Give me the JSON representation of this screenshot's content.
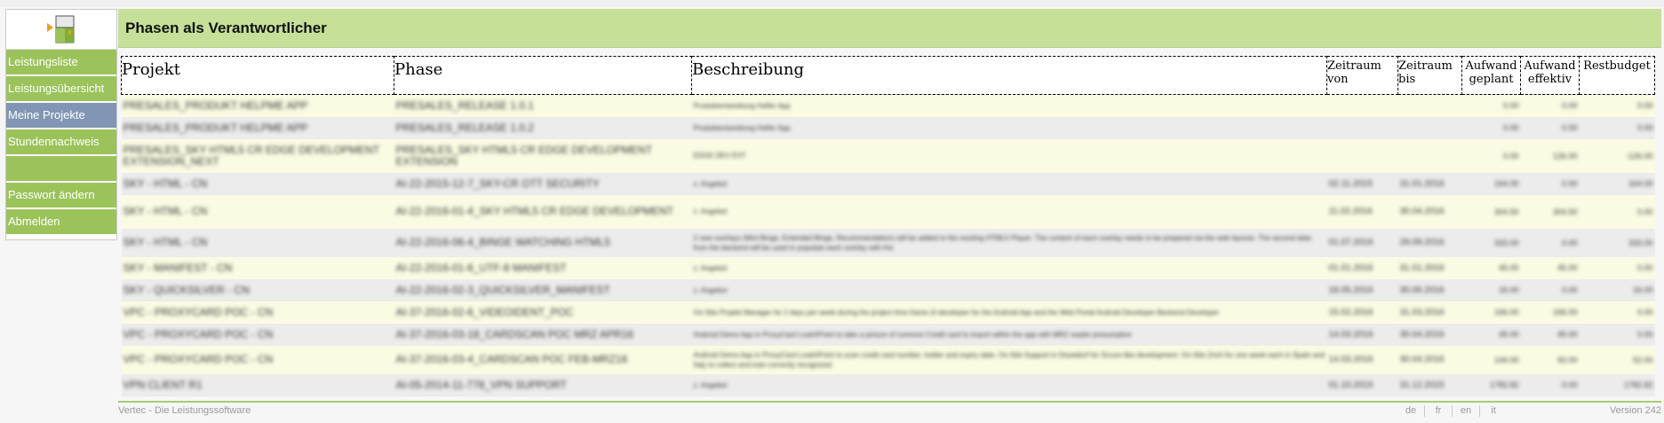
{
  "sidebar": {
    "items": [
      {
        "label": "Leistungsliste",
        "active": false
      },
      {
        "label": "Leistungsübersicht",
        "active": false
      },
      {
        "label": "Meine Projekte",
        "active": true
      },
      {
        "label": "Stundennachweis",
        "active": false
      },
      {
        "label": "",
        "active": false
      },
      {
        "label": "Passwort ändern",
        "active": false
      },
      {
        "label": "Abmelden",
        "active": false
      }
    ]
  },
  "header": {
    "title": "Phasen als Verantwortlicher"
  },
  "table": {
    "columns": {
      "projekt": "Projekt",
      "phase": "Phase",
      "beschreibung": "Beschreibung",
      "zeitraum_von": "Zeitraum von",
      "zeitraum_bis": "Zeitraum bis",
      "aufwand_geplant": "Aufwand geplant",
      "aufwand_effektiv": "Aufwand effektiv",
      "restbudget": "Restbudget"
    },
    "rows": [
      {
        "projekt": "PRESALES_PRODUKT HELPME APP",
        "phase": "PRESALES_RELEASE 1.0.1",
        "beschreibung": "Produktentwicklung Helfer App",
        "von": "",
        "bis": "",
        "geplant": "0.00",
        "effektiv": "0.00",
        "rest": "0.00"
      },
      {
        "projekt": "PRESALES_PRODUKT HELPME APP",
        "phase": "PRESALES_RELEASE 1.0.2",
        "beschreibung": "Produktentwicklung Helfer App",
        "von": "",
        "bis": "",
        "geplant": "0.00",
        "effektiv": "0.00",
        "rest": "0.00"
      },
      {
        "projekt": "PRESALES_SKY HTML5 CR EDGE DEVELOPMENT EXTENSION_NEXT",
        "phase": "PRESALES_SKY HTML5 CR EDGE DEVELOPMENT EXTENSION",
        "beschreibung": "EDGE DEV EXT",
        "von": "",
        "bis": "",
        "geplant": "0.00",
        "effektiv": "126.00",
        "rest": "-126.00"
      },
      {
        "projekt": "SKY - HTML - CN",
        "phase": "AI-22-2015-12-7_SKY-CR OTT SECURITY",
        "beschreibung": "z. Angebot",
        "von": "02.11.2015",
        "bis": "31.01.2016",
        "geplant": "164.00",
        "effektiv": "0.00",
        "rest": "164.00"
      },
      {
        "projekt": "SKY - HTML - CN",
        "phase": "AI-22-2016-01-4_SKY HTML5 CR EDGE DEVELOPMENT",
        "beschreibung": "z. Angebot",
        "von": "11.02.2016",
        "bis": "30.04.2016",
        "geplant": "304.50",
        "effektiv": "304.50",
        "rest": "0.00"
      },
      {
        "projekt": "SKY - HTML - CN",
        "phase": "AI-22-2016-06-4_BINGE WATCHING HTML5",
        "beschreibung": "2 new overlays (Mini Binge, Extended Binge, Recommendation) will be added to the existing HTML5 Player. The content of each overlay needs to be prepared via the web layouts. The second data from the backend will be used to populate each overlay with the",
        "von": "01.07.2016",
        "bis": "29.09.2016",
        "geplant": "333.00",
        "effektiv": "0.00",
        "rest": "333.00"
      },
      {
        "projekt": "SKY - MANIFEST - CN",
        "phase": "AI-22-2016-01-6_UTF-8 MANIFEST",
        "beschreibung": "z. Angebot",
        "von": "01.01.2016",
        "bis": "31.01.2016",
        "geplant": "45.00",
        "effektiv": "45.00",
        "rest": "0.00"
      },
      {
        "projekt": "SKY - QUICKSILVER - CN",
        "phase": "AI-22-2016-02-3_QUICKSILVER_MANIFEST",
        "beschreibung": "z. Angebot",
        "von": "18.05.2016",
        "bis": "30.06.2016",
        "geplant": "16.00",
        "effektiv": "0.00",
        "rest": "16.00"
      },
      {
        "projekt": "VPC - PROXYCARD POC - CN",
        "phase": "AI-37-2016-02-6_VIDEOIDENT_POC",
        "beschreibung": "On-Site Projekt Manager for 2 days per week during the project time frame (4 developer for the Android App and the Web Portal Android Developer Backend Developer",
        "von": "15.02.2016",
        "bis": "31.03.2016",
        "geplant": "166.00",
        "effektiv": "166.00",
        "rest": "0.00"
      },
      {
        "projekt": "VPC - PROXYCARD POC - CN",
        "phase": "AI-37-2016-03-18_CARDSCAN POC MRZ APR16",
        "beschreibung": "Android Demo App in ProxyCard LookAPoint to take a picture of common Credit card to import within the app with MRZ reader presumptive",
        "von": "14.03.2016",
        "bis": "30.04.2016",
        "geplant": "45.00",
        "effektiv": "45.00",
        "rest": "0.00"
      },
      {
        "projekt": "VPC - PROXYCARD POC - CN",
        "phase": "AI-37-2016-03-4_CARDSCAN POC FEB-MRZ16",
        "beschreibung": "Android Demo App in ProxyCard LookAPoint to scan credit card number, holder and expiry date. On-Site Support in Dsseldorf for Scrum-like development. On-Site Zrich for one week each in Spain and Italy to collect and train correctly recognized",
        "von": "14.03.2016",
        "bis": "30.04.2016",
        "geplant": "144.00",
        "effektiv": "92.00",
        "rest": "52.00"
      },
      {
        "projekt": "VPN CLIENT R1",
        "phase": "AI-05-2014-11-778_VPN SUPPORT",
        "beschreibung": "z. Angebot",
        "von": "01.10.2015",
        "bis": "31.12.2015",
        "geplant": "1782.82",
        "effektiv": "0.00",
        "rest": "1782.82"
      }
    ]
  },
  "footer": {
    "app_name": "Vertec - Die Leistungssoftware",
    "languages": [
      "de",
      "fr",
      "en",
      "it"
    ],
    "version": "Version 242"
  },
  "colors": {
    "nav_green": "#9bc35a",
    "nav_active": "#8096b4",
    "header_green": "#c6e09a",
    "row_yellow": "#fbfbe4",
    "row_gray": "#ececec"
  }
}
